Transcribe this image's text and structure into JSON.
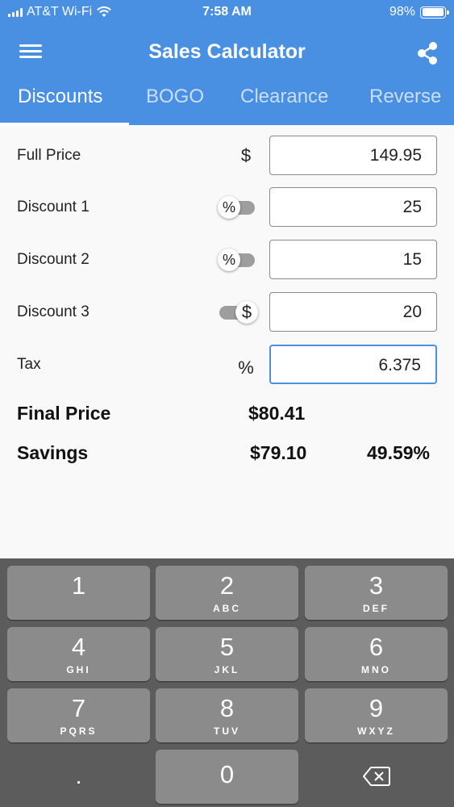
{
  "status_bar": {
    "carrier": "AT&T Wi-Fi",
    "time": "7:58 AM",
    "battery": "98%",
    "battery_level": 0.98
  },
  "header": {
    "title": "Sales Calculator",
    "menu_icon": "hamburger-menu-icon",
    "share_icon": "share-icon"
  },
  "tabs": [
    {
      "label": "Discounts",
      "active": true
    },
    {
      "label": "BOGO",
      "active": false
    },
    {
      "label": "Clearance",
      "active": false
    },
    {
      "label": "Reverse",
      "active": false
    }
  ],
  "form": {
    "full_price": {
      "label": "Full Price",
      "symbol": "$",
      "value": "149.95"
    },
    "discount1": {
      "label": "Discount 1",
      "toggle_symbol": "%",
      "toggle_state": "percent",
      "value": "25"
    },
    "discount2": {
      "label": "Discount 2",
      "toggle_symbol": "%",
      "toggle_state": "percent",
      "value": "15"
    },
    "discount3": {
      "label": "Discount 3",
      "toggle_symbol": "$",
      "toggle_state": "dollar",
      "value": "20"
    },
    "tax": {
      "label": "Tax",
      "symbol": "%",
      "value": "6.375"
    }
  },
  "results": {
    "final_price_label": "Final Price",
    "final_price_value": "$80.41",
    "savings_label": "Savings",
    "savings_value": "$79.10",
    "savings_percent": "49.59%"
  },
  "keyboard": {
    "keys": [
      {
        "num": "1",
        "letters": ""
      },
      {
        "num": "2",
        "letters": "ABC"
      },
      {
        "num": "3",
        "letters": "DEF"
      },
      {
        "num": "4",
        "letters": "GHI"
      },
      {
        "num": "5",
        "letters": "JKL"
      },
      {
        "num": "6",
        "letters": "MNO"
      },
      {
        "num": "7",
        "letters": "PQRS"
      },
      {
        "num": "8",
        "letters": "TUV"
      },
      {
        "num": "9",
        "letters": "WXYZ"
      },
      {
        "num": ".",
        "letters": ""
      },
      {
        "num": "0",
        "letters": ""
      }
    ],
    "backspace_icon": "backspace-icon"
  },
  "colors": {
    "primary": "#4a90e2",
    "keyboard_bg": "#5c5c5c",
    "key_bg": "#8b8b8b"
  }
}
